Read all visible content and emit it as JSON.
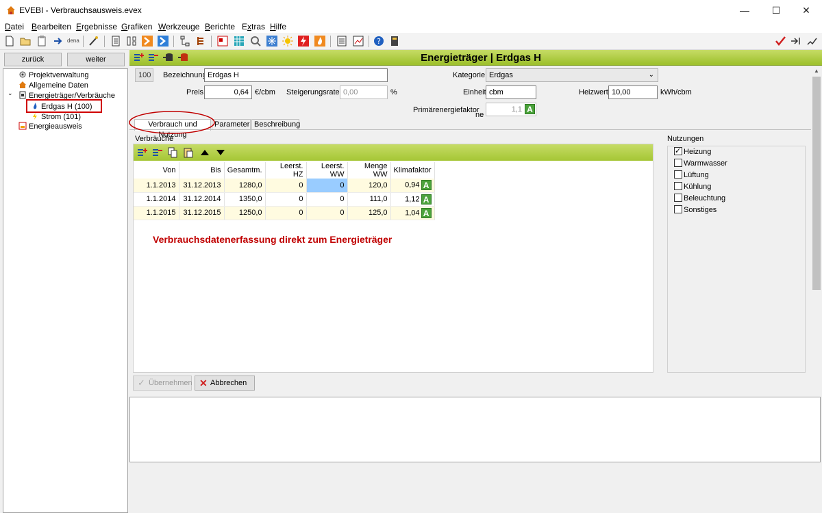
{
  "app": {
    "title": "EVEBI - Verbrauchsausweis.evex"
  },
  "window_controls": {
    "minimize": "—",
    "maximize": "☐",
    "close": "✕"
  },
  "menu": [
    {
      "pre": "",
      "u": "D",
      "post": "atei"
    },
    {
      "pre": "",
      "u": "B",
      "post": "earbeiten"
    },
    {
      "pre": "",
      "u": "E",
      "post": "rgebnisse"
    },
    {
      "pre": "",
      "u": "G",
      "post": "rafiken"
    },
    {
      "pre": "",
      "u": "W",
      "post": "erkzeuge"
    },
    {
      "pre": "",
      "u": "B",
      "post": "erichte"
    },
    {
      "pre": "E",
      "u": "x",
      "post": "tras"
    },
    {
      "pre": "",
      "u": "H",
      "post": "ilfe"
    }
  ],
  "toolbar_dena_label": "dena",
  "nav": {
    "back": "zurück",
    "forward": "weiter"
  },
  "tree": [
    "Projektverwaltung",
    "Allgemeine Daten",
    "Energieträger/Verbräuche",
    "Erdgas H (100)",
    "Strom (101)",
    "Energieausweis"
  ],
  "header": {
    "title": "Energieträger | Erdgas H"
  },
  "form": {
    "id": "100",
    "bezeichnung_label": "Bezeichnung",
    "bezeichnung_value": "Erdgas H",
    "kategorie_label": "Kategorie",
    "kategorie_value": "Erdgas",
    "preis_label": "Preis",
    "preis_value": "0,64",
    "preis_unit": "€/cbm",
    "steigerung_label": "Steigerungsrate",
    "steigerung_value": "0,00",
    "steigerung_unit": "%",
    "einheit_label": "Einheit",
    "einheit_value": "cbm",
    "heizwert_label": "Heizwert",
    "heizwert_value": "10,00",
    "heizwert_unit": "kWh/cbm",
    "pef_label": "Primärenergiefaktor",
    "pef_sub": "ne",
    "pef_value": "1,1",
    "pef_badge": "A"
  },
  "tabs": [
    "Verbrauch und Nutzung",
    "Parameter",
    "Beschreibung"
  ],
  "verbraeuche": {
    "section_label": "Verbräuche",
    "columns": [
      "Von",
      "Bis",
      "Gesamtm.",
      "Leerst. HZ",
      "Leerst. WW",
      "Menge WW",
      "Klimafaktor"
    ],
    "rows": [
      {
        "von": "1.1.2013",
        "bis": "31.12.2013",
        "gesamt": "1280,0",
        "hz": "0",
        "ww": "0",
        "menge": "120,0",
        "klima": "0,94",
        "badge": "A"
      },
      {
        "von": "1.1.2014",
        "bis": "31.12.2014",
        "gesamt": "1350,0",
        "hz": "0",
        "ww": "0",
        "menge": "111,0",
        "klima": "1,12",
        "badge": "A"
      },
      {
        "von": "1.1.2015",
        "bis": "31.12.2015",
        "gesamt": "1250,0",
        "hz": "0",
        "ww": "0",
        "menge": "125,0",
        "klima": "1,04",
        "badge": "A"
      }
    ],
    "annotation": "Verbrauchsdatenerfassung direkt zum Energieträger"
  },
  "nutzungen": {
    "label": "Nutzungen",
    "items": [
      {
        "label": "Heizung",
        "checked": true
      },
      {
        "label": "Warmwasser",
        "checked": false
      },
      {
        "label": "Lüftung",
        "checked": false
      },
      {
        "label": "Kühlung",
        "checked": false
      },
      {
        "label": "Beleuchtung",
        "checked": false
      },
      {
        "label": "Sonstiges",
        "checked": false
      }
    ]
  },
  "buttons": {
    "apply": "Übernehmen",
    "cancel": "Abbrechen"
  },
  "colors": {
    "accent_green": "#9cbf2a",
    "annotation_red": "#c00000",
    "highlight_red": "#d00000",
    "selection_blue": "#99ccff"
  }
}
